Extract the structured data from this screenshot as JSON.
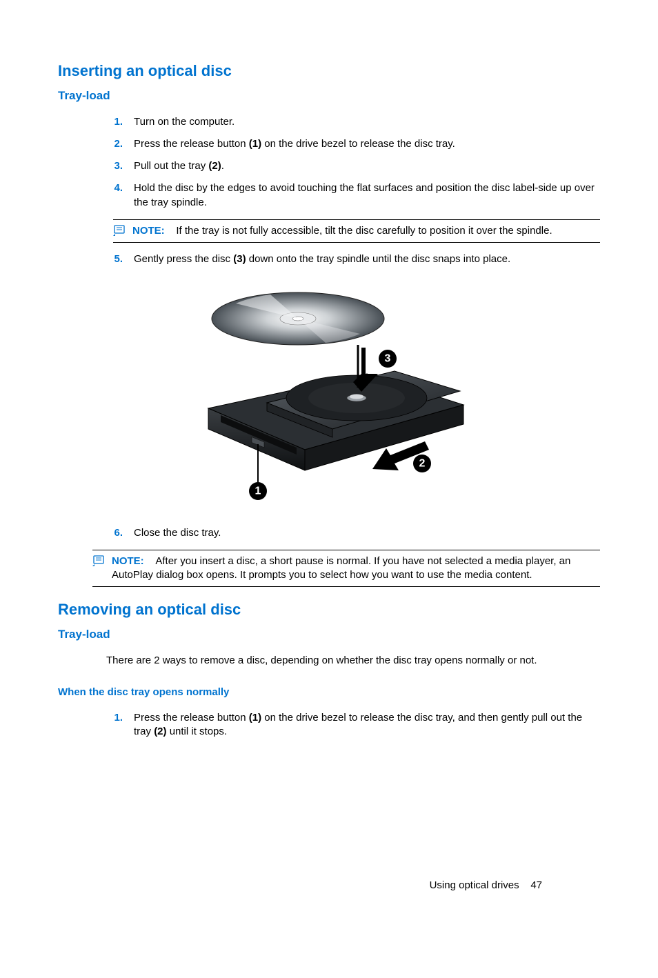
{
  "section1": {
    "heading": "Inserting an optical disc",
    "subheading": "Tray-load",
    "steps": [
      {
        "num": "1.",
        "parts": [
          "Turn on the computer."
        ]
      },
      {
        "num": "2.",
        "parts": [
          "Press the release button ",
          "(1)",
          " on the drive bezel to release the disc tray."
        ]
      },
      {
        "num": "3.",
        "parts": [
          "Pull out the tray ",
          "(2)",
          "."
        ]
      },
      {
        "num": "4.",
        "parts": [
          "Hold the disc by the edges to avoid touching the flat surfaces and position the disc label-side up over the tray spindle."
        ]
      }
    ],
    "note1": {
      "label": "NOTE:",
      "text": "If the tray is not fully accessible, tilt the disc carefully to position it over the spindle."
    },
    "step5": {
      "num": "5.",
      "parts": [
        "Gently press the disc ",
        "(3)",
        " down onto the tray spindle until the disc snaps into place."
      ]
    },
    "step6": {
      "num": "6.",
      "parts": [
        "Close the disc tray."
      ]
    },
    "note2": {
      "label": "NOTE:",
      "text": "After you insert a disc, a short pause is normal. If you have not selected a media player, an AutoPlay dialog box opens. It prompts you to select how you want to use the media content."
    },
    "callouts": {
      "c1": "1",
      "c2": "2",
      "c3": "3"
    }
  },
  "section2": {
    "heading": "Removing an optical disc",
    "subheading": "Tray-load",
    "intro": "There are 2 ways to remove a disc, depending on whether the disc tray opens normally or not.",
    "subsubheading": "When the disc tray opens normally",
    "steps": [
      {
        "num": "1.",
        "parts": [
          "Press the release button ",
          "(1)",
          " on the drive bezel to release the disc tray, and then gently pull out the tray ",
          "(2)",
          " until it stops."
        ]
      }
    ]
  },
  "footer": {
    "section_name": "Using optical drives",
    "page_number": "47"
  }
}
